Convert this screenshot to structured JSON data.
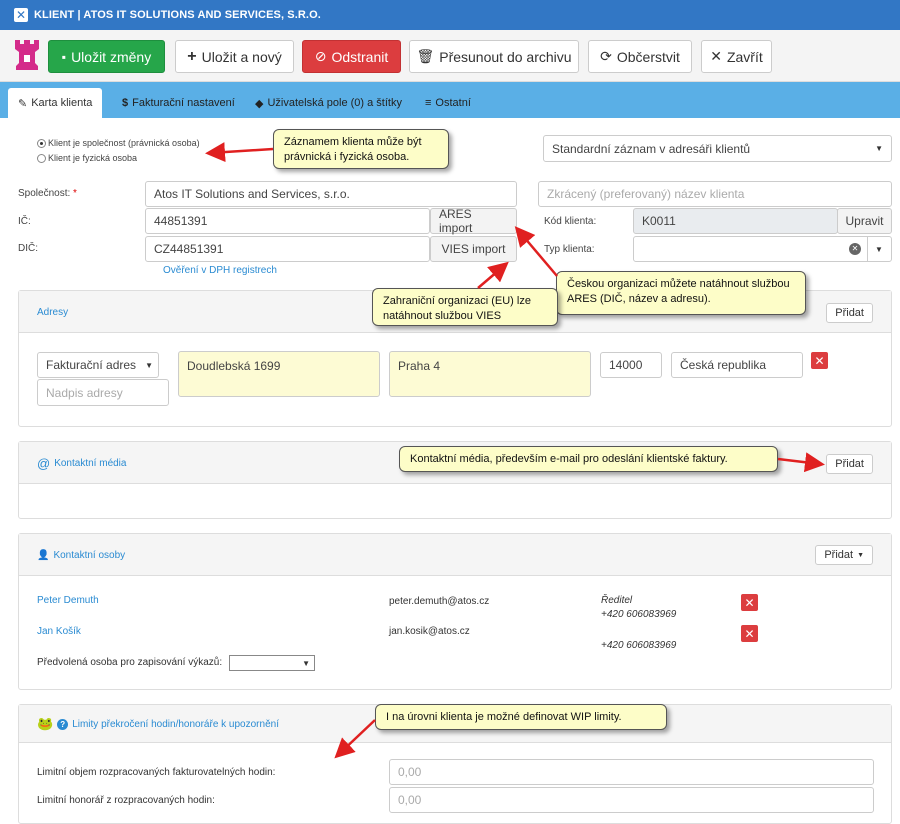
{
  "window": {
    "title": "KLIENT | ATOS IT SOLUTIONS AND SERVICES, S.R.O."
  },
  "toolbar": {
    "save": "Uložit změny",
    "save_new": "Uložit a nový",
    "delete": "Odstranit",
    "archive": "Přesunout do archivu",
    "refresh": "Občerstvit",
    "close": "Zavřít"
  },
  "tabs": [
    "Karta klienta",
    "Fakturační nastavení",
    "Uživatelská pole (0) a štítky",
    "Ostatní"
  ],
  "form": {
    "radio_company": "Klient je společnost (právnická osoba)",
    "radio_person": "Klient je fyzická osoba",
    "record_type": "Standardní záznam v adresáři klientů",
    "company_label": "Společnost:",
    "required_mark": "*",
    "company_value": "Atos IT Solutions and Services, s.r.o.",
    "short_name_placeholder": "Zkrácený (preferovaný) název klienta",
    "ic_label": "IČ:",
    "ic_value": "44851391",
    "ares_btn": "ARES import",
    "client_code_label": "Kód klienta:",
    "client_code_value": "K0011",
    "edit_btn": "Upravit",
    "dic_label": "DIČ:",
    "dic_value": "CZ44851391",
    "vies_btn": "VIES import",
    "client_type_label": "Typ klienta:",
    "vat_link": "Ověření v DPH registrech"
  },
  "addresses": {
    "title": "Adresy",
    "add": "Přidat",
    "type": "Fakturační adres",
    "street": "Doudlebská 1699",
    "city": "Praha 4",
    "zip": "14000",
    "country": "Česká republika",
    "title_placeholder": "Nadpis adresy"
  },
  "media": {
    "title": "Kontaktní média",
    "add": "Přidat"
  },
  "persons": {
    "title": "Kontaktní osoby",
    "add": "Přidat",
    "rows": [
      {
        "name": "Peter Demuth",
        "email": "peter.demuth@atos.cz",
        "role": "Ředitel",
        "phone": "+420 606083969"
      },
      {
        "name": "Jan Košík",
        "email": "jan.kosik@atos.cz",
        "role": "",
        "phone": "+420 606083969"
      }
    ],
    "default_label": "Předvolená osoba pro zapisování výkazů:"
  },
  "limits": {
    "title": "Limity překročení hodin/honoráře k upozornění",
    "hours_label": "Limitní objem rozpracovaných fakturovatelných hodin:",
    "hours_value": "0,00",
    "fee_label": "Limitní honorář z rozpracovaných hodin:",
    "fee_value": "0,00"
  },
  "callouts": {
    "c1": "Záznamem klienta může být právnická i fyzická osoba.",
    "c2": "Českou organizaci můžete natáhnout službou ARES (DIČ, název a adresu).",
    "c3": "Zahraniční organizaci (EU) lze natáhnout službou VIES",
    "c4": "Kontaktní média, především e-mail pro odeslání klientské faktury.",
    "c5": "I na úrovni klienta je možné definovat WIP limity."
  },
  "colors": {
    "titlebar": "#3277c5",
    "tabs": "#5aafe6",
    "save": "#26a64a",
    "delete": "#dc3d3f",
    "link": "#2a8bd2",
    "callout": "#fdfdc8",
    "arrow": "#e02020"
  }
}
